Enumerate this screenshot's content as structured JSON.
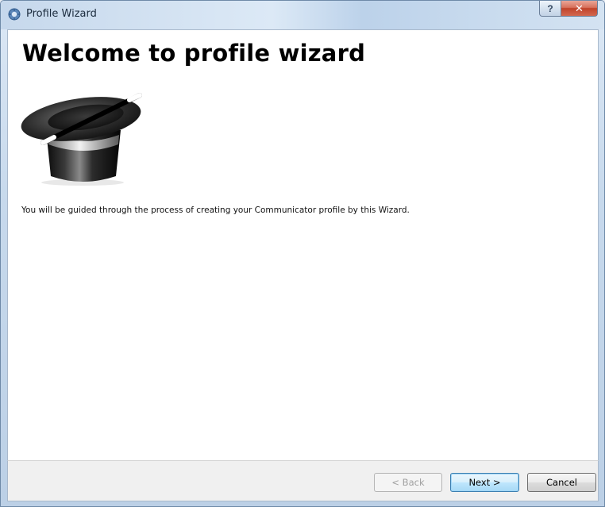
{
  "window": {
    "title": "Profile Wizard",
    "help_label": "?",
    "close_label": "✕"
  },
  "page": {
    "heading": "Welcome to profile wizard",
    "image": "magic-hat-wand-icon",
    "description": "You will be guided through the process of creating your Communicator profile by this Wizard."
  },
  "buttons": {
    "back": {
      "label": "< Back",
      "enabled": false
    },
    "next": {
      "label": "Next >",
      "enabled": true,
      "default": true
    },
    "cancel": {
      "label": "Cancel",
      "enabled": true
    }
  },
  "colors": {
    "titlebar": "#c6d8ec",
    "close_button": "#c0432a",
    "default_button_border": "#3c7fb1",
    "content_background": "#ffffff",
    "footer_background": "#f0f0f0"
  }
}
